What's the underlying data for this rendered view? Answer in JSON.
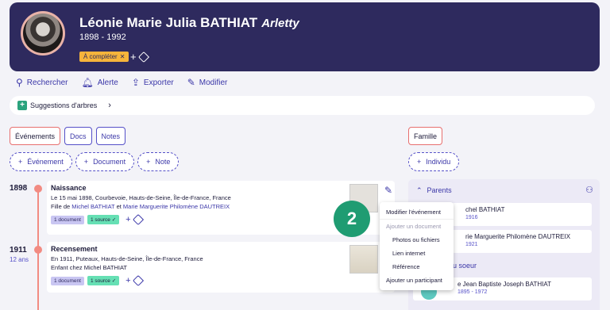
{
  "header": {
    "name": "Léonie Marie Julia BATHIAT",
    "nickname": "Arletty",
    "dates": "1898 - 1992",
    "badge": "À compléter",
    "badge_close": "✕"
  },
  "toolbar": {
    "search": "Rechercher",
    "alert": "Alerte",
    "export": "Exporter",
    "edit": "Modifier"
  },
  "suggestions": {
    "label": "Suggestions d'arbres"
  },
  "tabs": {
    "events": "Événements",
    "docs": "Docs",
    "notes": "Notes",
    "family": "Famille"
  },
  "add_buttons": {
    "event": "Événement",
    "document": "Document",
    "note": "Note",
    "individu": "Individu"
  },
  "events": [
    {
      "year": "1898",
      "age": "",
      "title": "Naissance",
      "line1": "Le 15 mai 1898, Courbevoie, Hauts-de-Seine, Île-de-France, France",
      "line2_prefix": "Fille de",
      "parent1": "Michel BATHIAT",
      "line2_mid": "et",
      "parent2": "Marie Marguerite Philomène DAUTREIX",
      "doc_badge": "1 document",
      "source_badge": "1 source ✓"
    },
    {
      "year": "1911",
      "age": "12 ans",
      "title": "Recensement",
      "line1": "En 1911, Puteaux, Hauts-de-Seine, Île-de-France, France",
      "line2": "Enfant chez Michel BATHIAT",
      "doc_badge": "1 document",
      "source_badge": "1 source ✓"
    }
  ],
  "menu": {
    "items": [
      "Modifier l'événement",
      "Ajouter un document",
      "Photos ou fichiers",
      "Lien internet",
      "Référence",
      "Ajouter un participant"
    ]
  },
  "step_badge": "2",
  "family": {
    "parents_label": "Parents",
    "siblings_label": "u soeur",
    "parent1_name": "chel BATHIAT",
    "parent1_dates": "1916",
    "parent2_name": "rie Marguerite Philomène DAUTREIX",
    "parent2_dates": "1921",
    "sibling_name": "e Jean Baptiste Joseph BATHIAT",
    "sibling_dates": "1895 - 1972"
  },
  "colors": {
    "header_bg": "#2e2a5e",
    "accent": "#3b37a8",
    "timeline": "#f28b82",
    "green": "#1f9c72"
  }
}
